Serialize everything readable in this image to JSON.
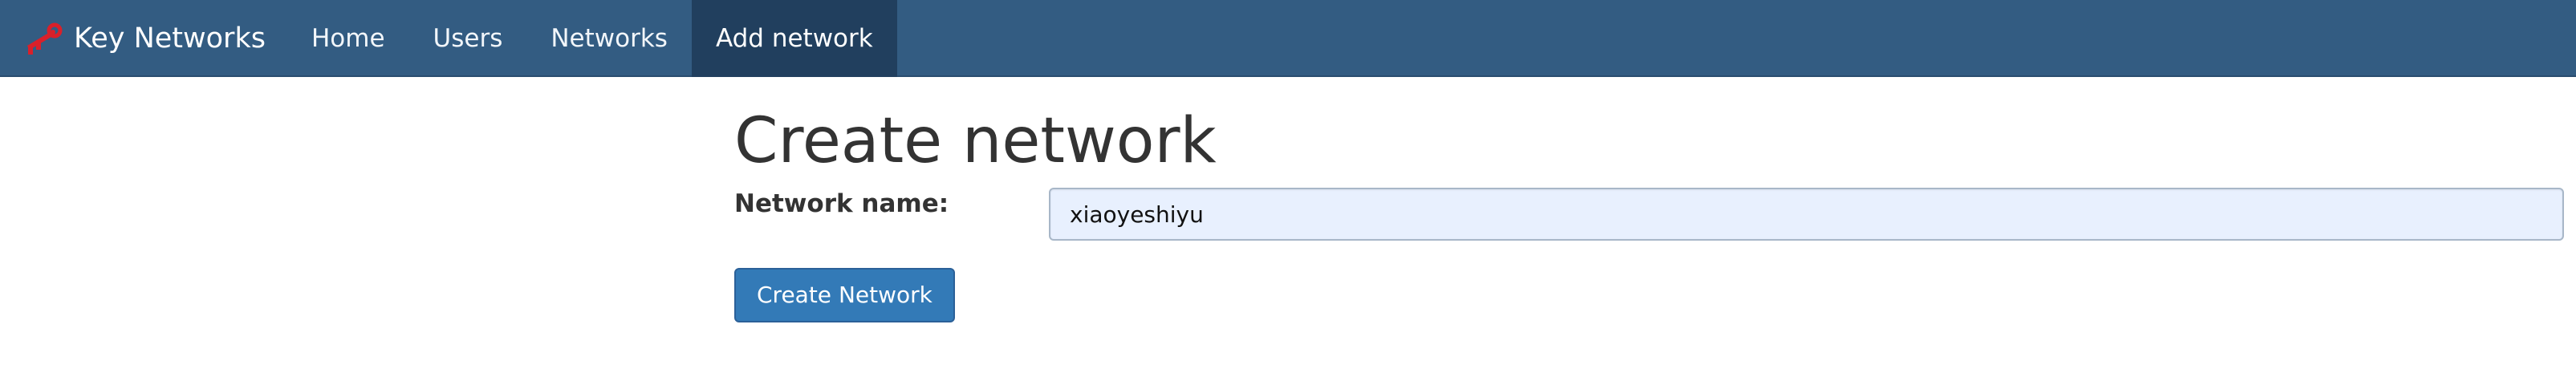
{
  "navbar": {
    "brand": {
      "icon": "key-icon",
      "icon_color": "#d9202a",
      "label": "Key Networks"
    },
    "items": [
      {
        "label": "Home",
        "active": false
      },
      {
        "label": "Users",
        "active": false
      },
      {
        "label": "Networks",
        "active": false
      },
      {
        "label": "Add network",
        "active": true
      }
    ],
    "background_color": "#335c82",
    "active_color": "#213f5e"
  },
  "main": {
    "title": "Create network",
    "form": {
      "network_name_label": "Network name:",
      "network_name_value": "xiaoyeshiyu",
      "submit_label": "Create Network",
      "submit_color": "#337ab7"
    }
  }
}
